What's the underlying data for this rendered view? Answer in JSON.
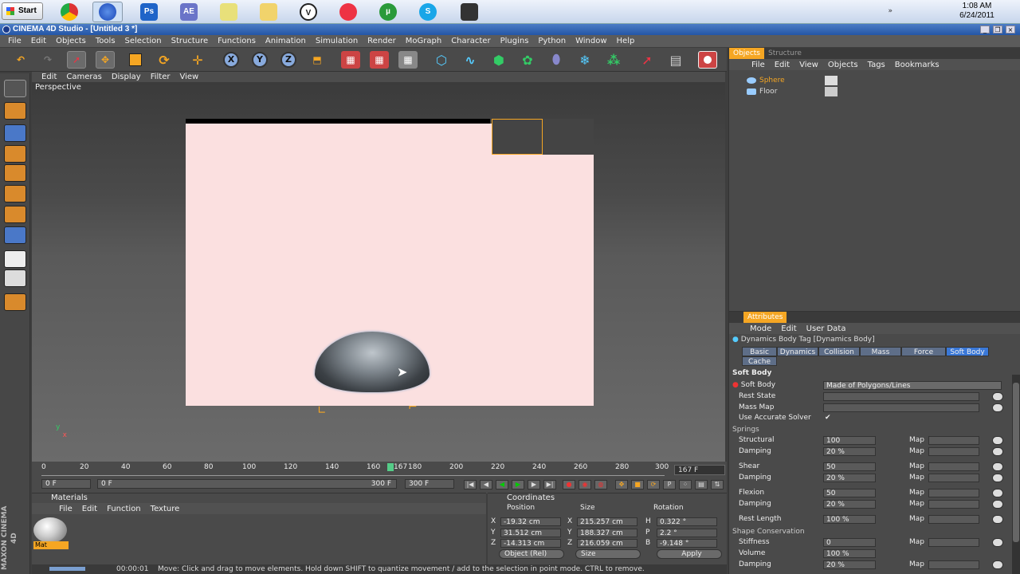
{
  "taskbar": {
    "start": "Start",
    "apps": [
      {
        "name": "chrome",
        "color": "#d33"
      },
      {
        "name": "cinema4d",
        "color": "#1a47b8"
      },
      {
        "name": "photoshop",
        "label": "Ps",
        "color": "#1f64c8"
      },
      {
        "name": "after-effects",
        "label": "AE",
        "color": "#6a74c8"
      },
      {
        "name": "sticky-notes",
        "color": "#e8e07a"
      },
      {
        "name": "folder",
        "color": "#f1d36b"
      },
      {
        "name": "vuze",
        "color": "#2a2a2a"
      },
      {
        "name": "angry-birds",
        "color": "#e34"
      },
      {
        "name": "utorrent",
        "color": "#2a9a3a"
      },
      {
        "name": "skype",
        "color": "#19a6e8"
      },
      {
        "name": "scanner",
        "color": "#333"
      }
    ],
    "time": "1:08 AM",
    "date": "6/24/2011"
  },
  "window": {
    "title": "CINEMA 4D Studio - [Untitled 3 *]"
  },
  "menu": [
    "File",
    "Edit",
    "Objects",
    "Tools",
    "Selection",
    "Structure",
    "Functions",
    "Animation",
    "Simulation",
    "Render",
    "MoGraph",
    "Character",
    "Plugins",
    "Python",
    "Window",
    "Help"
  ],
  "viewport": {
    "menu": [
      "Edit",
      "Cameras",
      "Display",
      "Filter",
      "View"
    ],
    "label": "Perspective"
  },
  "timeline": {
    "ticks": [
      "0",
      "20",
      "40",
      "60",
      "80",
      "100",
      "120",
      "140",
      "160",
      "167",
      "180",
      "200",
      "220",
      "240",
      "260",
      "280",
      "300"
    ],
    "current_frame": "167 F",
    "start": "0 F",
    "range_start": "0 F",
    "range_end": "300 F",
    "end": "300 F"
  },
  "materials": {
    "title": "Materials",
    "menu": [
      "File",
      "Edit",
      "Function",
      "Texture"
    ],
    "item": "Mat"
  },
  "coordinates": {
    "title": "Coordinates",
    "headers": [
      "Position",
      "Size",
      "Rotation"
    ],
    "rows": [
      {
        "axis": "X",
        "pos": "-19.32 cm",
        "size_axis": "X",
        "size": "215.257 cm",
        "rot_axis": "H",
        "rot": "0.322 °"
      },
      {
        "axis": "Y",
        "pos": "31.512 cm",
        "size_axis": "Y",
        "size": "188.327 cm",
        "rot_axis": "P",
        "rot": "2.2 °"
      },
      {
        "axis": "Z",
        "pos": "-14.313 cm",
        "size_axis": "Z",
        "size": "216.059 cm",
        "rot_axis": "B",
        "rot": "-9.148 °"
      }
    ],
    "mode": "Object (Rel)",
    "size_mode": "Size",
    "apply": "Apply"
  },
  "status": {
    "time": "00:00:01",
    "message": "Move: Click and drag to move elements. Hold down SHIFT to quantize movement / add to the selection in point mode. CTRL to remove.",
    "progress": 0.9
  },
  "brand": "MAXON CINEMA 4D",
  "objects": {
    "tabs": [
      "Objects",
      "Structure"
    ],
    "menu": [
      "File",
      "Edit",
      "View",
      "Objects",
      "Tags",
      "Bookmarks"
    ],
    "items": [
      "Sphere",
      "Floor"
    ]
  },
  "attributes": {
    "tab": "Attributes",
    "menu": [
      "Mode",
      "Edit",
      "User Data"
    ],
    "title": "Dynamics Body Tag [Dynamics Body]",
    "tabs": [
      "Basic",
      "Dynamics",
      "Collision",
      "Mass",
      "Force",
      "Soft Body",
      "Cache"
    ],
    "section": "Soft Body",
    "soft_body_label": "Soft Body",
    "soft_body_value": "Made of Polygons/Lines",
    "rest_state": "Rest State",
    "mass_map": "Mass Map",
    "accurate": "Use Accurate Solver",
    "accurate_check": "✔",
    "springs": "Springs",
    "map": "Map",
    "rows": [
      {
        "label": "Structural",
        "value": "100"
      },
      {
        "label": "Damping",
        "value": "20 %"
      },
      {
        "label": "Shear",
        "value": "50"
      },
      {
        "label": "Damping",
        "value": "20 %"
      },
      {
        "label": "Flexion",
        "value": "50"
      },
      {
        "label": "Damping",
        "value": "20 %"
      },
      {
        "label": "Rest Length",
        "value": "100 %"
      }
    ],
    "shape": "Shape Conservation",
    "shape_rows": [
      {
        "label": "Stiffness",
        "value": "0"
      },
      {
        "label": "Volume",
        "value": "100 %"
      },
      {
        "label": "Damping",
        "value": "20 %"
      }
    ]
  }
}
